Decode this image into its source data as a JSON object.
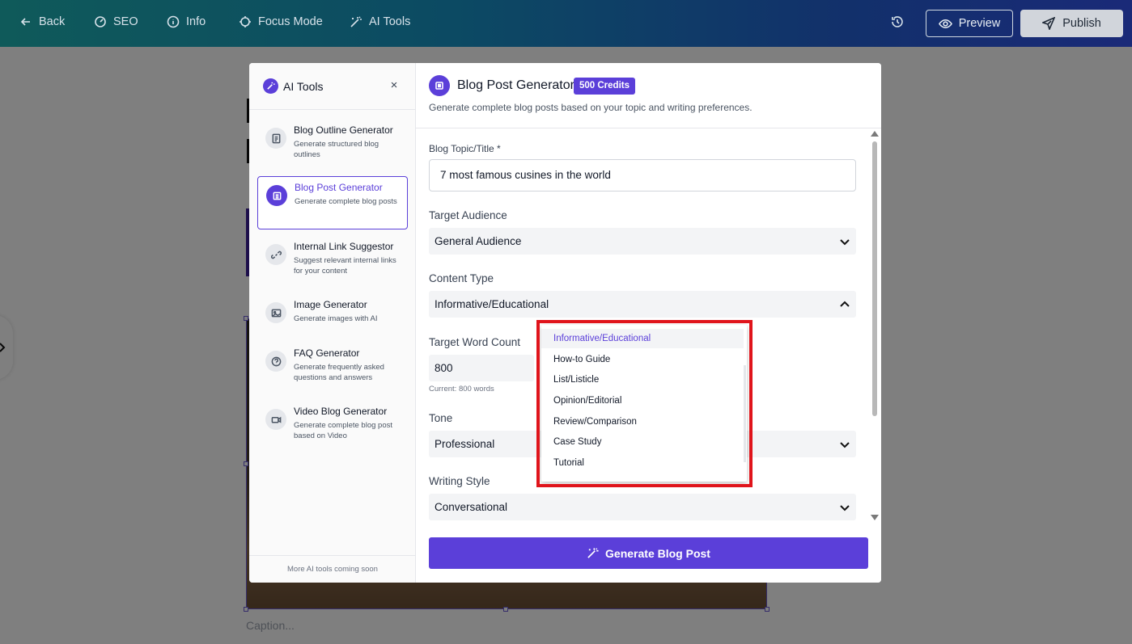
{
  "topbar": {
    "back": "Back",
    "seo": "SEO",
    "info": "Info",
    "focus_mode": "Focus Mode",
    "ai_tools": "AI Tools",
    "preview": "Preview",
    "publish": "Publish"
  },
  "editor": {
    "caption_placeholder": "Caption..."
  },
  "left_panel": {
    "title": "AI Tools",
    "close": "×",
    "tools": [
      {
        "name": "Blog Outline Generator",
        "desc": "Generate structured blog outlines",
        "icon": "document-icon"
      },
      {
        "name": "Blog Post Generator",
        "desc": "Generate complete blog posts",
        "icon": "document-icon",
        "active": true
      },
      {
        "name": "Internal Link Suggestor",
        "desc": "Suggest relevant internal links for your content",
        "icon": "link-icon"
      },
      {
        "name": "Image Generator",
        "desc": "Generate images with AI",
        "icon": "image-icon"
      },
      {
        "name": "FAQ Generator",
        "desc": "Generate frequently asked questions and answers",
        "icon": "help-icon"
      },
      {
        "name": "Video Blog Generator",
        "desc": "Generate complete blog post based on Video",
        "icon": "video-icon"
      }
    ],
    "footer": "More AI tools coming soon"
  },
  "generator": {
    "title": "Blog Post Generator",
    "credits": "500 Credits",
    "subtitle": "Generate complete blog posts based on your topic and writing preferences.",
    "topic_label": "Blog Topic/Title *",
    "topic_value": "7 most famous cusines in the world",
    "audience_label": "Target Audience",
    "audience_value": "General Audience",
    "content_type_label": "Content Type",
    "content_type_value": "Informative/Educational",
    "word_count_label": "Target Word Count",
    "word_count_value": "800",
    "word_count_hint": "Current: 800 words",
    "tone_label": "Tone",
    "tone_value": "Professional",
    "style_label": "Writing Style",
    "style_value": "Conversational",
    "generate_button": "Generate Blog Post"
  },
  "content_type_options": [
    "Informative/Educational",
    "How-to Guide",
    "List/Listicle",
    "Opinion/Editorial",
    "Review/Comparison",
    "Case Study",
    "Tutorial"
  ],
  "colors": {
    "accent": "#5b3fd9",
    "highlight": "#e0141b"
  }
}
